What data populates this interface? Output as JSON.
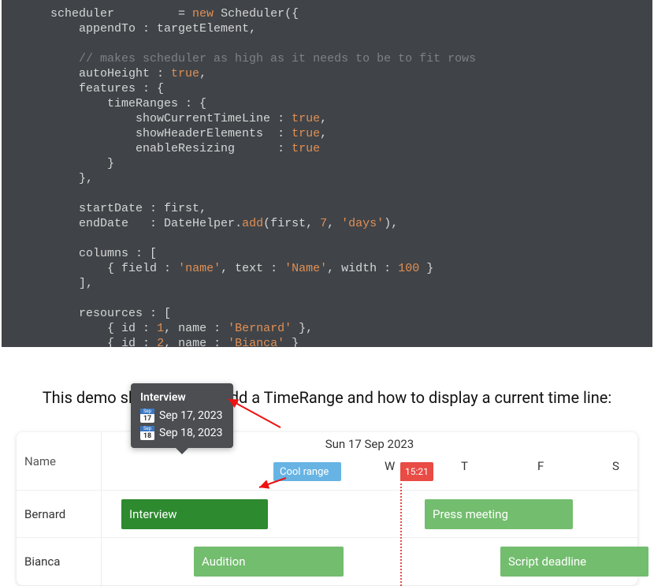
{
  "code": {
    "t": {
      "var_scheduler": "scheduler",
      "eq": " = ",
      "new": "new",
      "cls_scheduler": " Scheduler",
      "op_paren_brace": "({",
      "appendTo": "appendTo",
      "colon_sp": " : ",
      "targetElement": "targetElement",
      "comma": ",",
      "comment1": "// makes scheduler as high as it needs to be to fit rows",
      "autoHeight": "autoHeight",
      "true": "true",
      "features": "features",
      "brace": " : {",
      "timeRanges": "timeRanges",
      "showCurrentTimeLine": "showCurrentTimeLine",
      "showHeaderElements": "showHeaderElements",
      "enableResizing": "enableResizing",
      "close_brace": "}",
      "close_braces": "},",
      "startDate": "startDate",
      "first": "first",
      "endDate": "endDate",
      "DateHelper": "DateHelper",
      "add": "add",
      "seven": "7",
      "days": "'days'",
      "close_paren": "),",
      "columns": "columns",
      "arr": " : [",
      "field": "field",
      "name_s": "'name'",
      "text": "text",
      "Name_s": "'Name'",
      "width": "width",
      "hundred": "100",
      "close_arr": "],",
      "resources": "resources",
      "id": "id",
      "one": "1",
      "two": "2",
      "name_k": "name",
      "bernard_s": "'Bernard'",
      "bianca_s": "'Bianca'"
    }
  },
  "demo": {
    "title": "This demo shows how to add a TimeRange and how to display a current time line:",
    "nameHeader": "Name",
    "superHeader": "Sun 17 Sep 2023",
    "cool": "Cool range",
    "now": "15:21",
    "ticks": {
      "W": "W",
      "T": "T",
      "F": "F",
      "S": "S"
    },
    "rows": [
      {
        "name": "Bernard"
      },
      {
        "name": "Bianca"
      }
    ],
    "events": {
      "interview": "Interview",
      "press": "Press meeting",
      "audition": "Audition",
      "deadline": "Script deadline"
    }
  },
  "tooltip": {
    "title": "Interview",
    "line1": {
      "month": "Sep",
      "day": "17",
      "text": "Sep 17, 2023"
    },
    "line2": {
      "month": "Sep",
      "day": "18",
      "text": "Sep 18, 2023"
    }
  }
}
